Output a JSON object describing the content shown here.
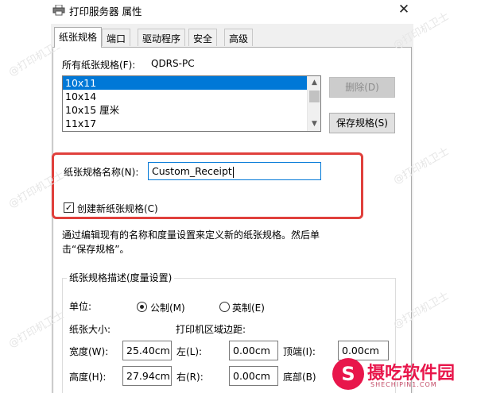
{
  "window": {
    "title": "打印服务器 属性",
    "close_glyph": "✕"
  },
  "tabs": [
    {
      "label": "纸张规格",
      "active": true
    },
    {
      "label": "端口",
      "active": false
    },
    {
      "label": "驱动程序",
      "active": false
    },
    {
      "label": "安全",
      "active": false
    },
    {
      "label": "高级",
      "active": false
    }
  ],
  "forms": {
    "all_label": "所有纸张规格(F):",
    "server_name": "QDRS-PC",
    "items": [
      "10x11",
      "10x14",
      "10x15 厘米",
      "11x17"
    ],
    "selected_index": 0,
    "delete_label": "删除(D)",
    "save_label": "保存规格(S)",
    "name_label": "纸张规格名称(N):",
    "name_value": "Custom_Receipt",
    "create_label": "创建新纸张规格(C)",
    "create_checked": true,
    "help_line1": "通过编辑现有的名称和度量设置来定义新的纸张规格。然后单",
    "help_line2": "击“保存规格”。"
  },
  "description": {
    "group_title": "纸张规格描述(度量设置)",
    "unit_label": "单位:",
    "metric_label": "公制(M)",
    "english_label": "英制(E)",
    "metric_selected": true,
    "paper_size_label": "纸张大小:",
    "margins_label": "打印机区域边距:",
    "width_label": "宽度(W):",
    "width_value": "25.40cm",
    "height_label": "高度(H):",
    "height_value": "27.94cm",
    "left_label": "左(L):",
    "left_value": "0.00cm",
    "right_label": "右(R):",
    "right_value": "0.00cm",
    "top_label": "顶端(I):",
    "top_value": "0.00cm",
    "bottom_label": "底部(B)"
  },
  "watermark": {
    "text": "@打印机卫士",
    "color": "#e6e6e6"
  },
  "logo": {
    "mark": "S",
    "name": "摄吃软件园",
    "url_text": "SHECHIPIN1.COM",
    "color": "#e8164b"
  },
  "colors": {
    "selection": "#0078d7",
    "highlight_border": "#e0403c"
  }
}
